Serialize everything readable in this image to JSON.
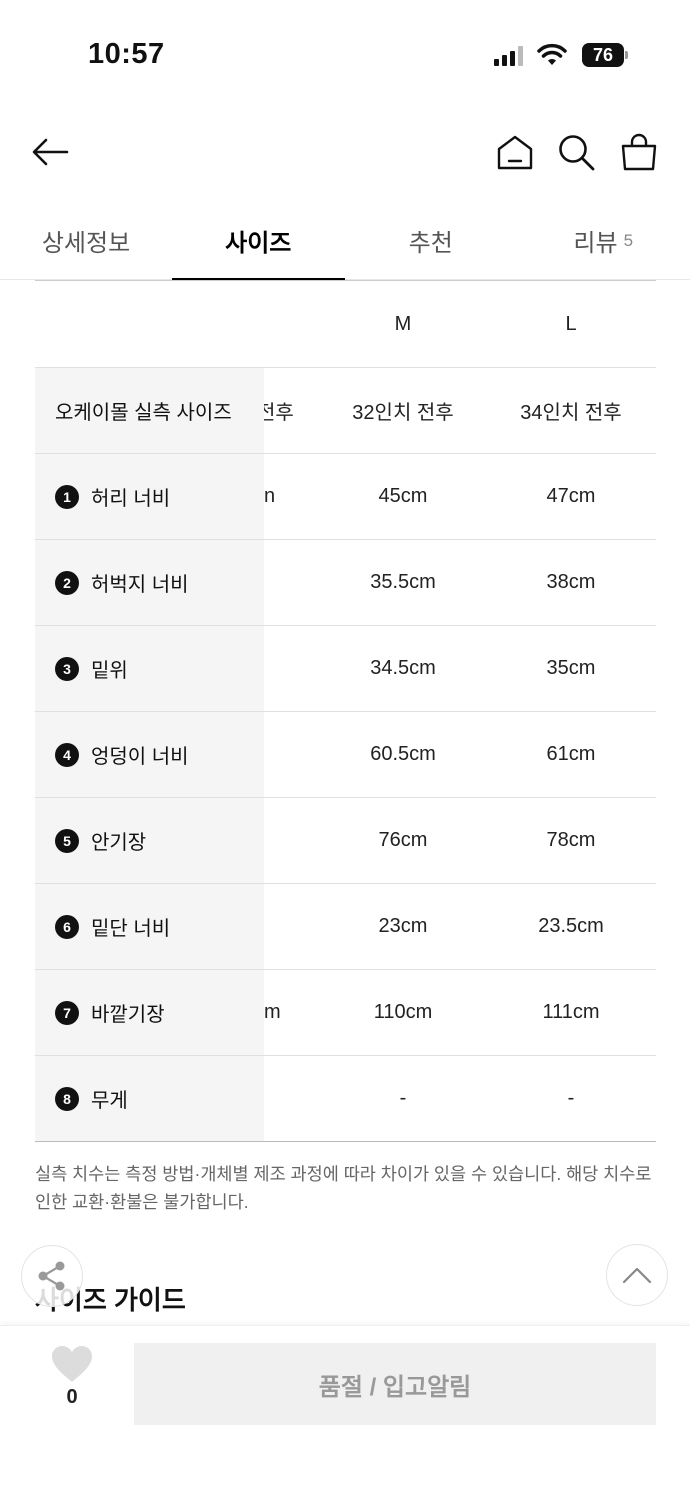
{
  "status": {
    "time": "10:57",
    "battery": "76"
  },
  "tabs": [
    {
      "label": "상세정보"
    },
    {
      "label": "사이즈"
    },
    {
      "label": "추천"
    },
    {
      "label": "리뷰",
      "count": "5"
    }
  ],
  "table": {
    "columns": [
      "M",
      "L"
    ],
    "rows": [
      {
        "label": "오케이몰 실측 사이즈",
        "partial": "전후",
        "m": "32인치 전후",
        "l": "34인치 전후"
      },
      {
        "num": "1",
        "label": "허리 너비",
        "partial": "n",
        "m": "45cm",
        "l": "47cm"
      },
      {
        "num": "2",
        "label": "허벅지 너비",
        "partial": "",
        "m": "35.5cm",
        "l": "38cm"
      },
      {
        "num": "3",
        "label": "밑위",
        "partial": "",
        "m": "34.5cm",
        "l": "35cm"
      },
      {
        "num": "4",
        "label": "엉덩이 너비",
        "partial": "",
        "m": "60.5cm",
        "l": "61cm"
      },
      {
        "num": "5",
        "label": "안기장",
        "partial": "",
        "m": "76cm",
        "l": "78cm"
      },
      {
        "num": "6",
        "label": "밑단 너비",
        "partial": "",
        "m": "23cm",
        "l": "23.5cm"
      },
      {
        "num": "7",
        "label": "바깥기장",
        "partial": "m",
        "m": "110cm",
        "l": "111cm"
      },
      {
        "num": "8",
        "label": "무게",
        "partial": "",
        "m": "-",
        "l": "-"
      }
    ]
  },
  "note": "실측 치수는 측정 방법·개체별 제조 과정에 따라 차이가 있을 수 있습니다. 해당 치수로 인한 교환·환불은 불가합니다.",
  "guide_title": "사이즈 가이드",
  "bottom": {
    "like_count": "0",
    "soldout_label": "품절 / 입고알림"
  },
  "icons": [
    "back-arrow-icon",
    "home-icon",
    "search-icon",
    "shopping-bag-icon",
    "share-icon",
    "chevron-up-icon",
    "heart-icon"
  ]
}
